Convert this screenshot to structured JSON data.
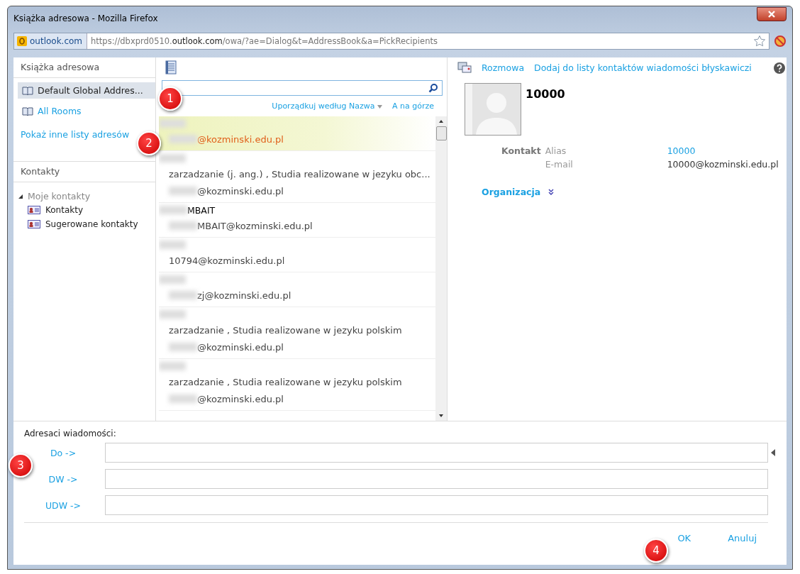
{
  "window": {
    "title": "Książka adresowa - Mozilla Firefox"
  },
  "address_bar": {
    "site": "outlook.com",
    "url_start": "https://dbxprd0510.",
    "url_domain": "outlook.com",
    "url_end": "/owa/?ae=Dialog&t=AddressBook&a=PickRecipients"
  },
  "sidebar": {
    "title": "Książka adresowa",
    "lists": [
      {
        "label": "Default Global Addres...",
        "selected": true
      },
      {
        "label": "All Rooms",
        "selected": false
      }
    ],
    "more_link": "Pokaż inne listy adresów",
    "contacts_title": "Kontakty",
    "tree": [
      {
        "label": "Moje kontakty",
        "expanded": true,
        "children": [
          {
            "label": "Kontakty"
          },
          {
            "label": "Sugerowane kontakty"
          }
        ]
      }
    ]
  },
  "list": {
    "sort": "Uporządkuj według Nazwa",
    "order": "A na górze",
    "rows": [
      {
        "selected": true,
        "name": "",
        "lines": [
          "@kozminski.edu.pl"
        ]
      },
      {
        "selected": false,
        "name": "",
        "lines": [
          "zarzadzanie (j. ang.) , Studia realizowane w jezyku obc...",
          "@kozminski.edu.pl"
        ]
      },
      {
        "selected": false,
        "name": "MBAIT",
        "lines": [
          "MBAIT@kozminski.edu.pl"
        ]
      },
      {
        "selected": false,
        "name": "",
        "lines": [
          "10794@kozminski.edu.pl"
        ]
      },
      {
        "selected": false,
        "name": "",
        "lines": [
          "zj@kozminski.edu.pl"
        ]
      },
      {
        "selected": false,
        "name": "",
        "lines": [
          "zarzadzanie , Studia realizowane w jezyku polskim",
          "@kozminski.edu.pl"
        ]
      },
      {
        "selected": false,
        "name": "",
        "lines": [
          "zarzadzanie , Studia realizowane w jezyku polskim",
          "@kozminski.edu.pl"
        ]
      }
    ]
  },
  "details": {
    "actions": [
      "Rozmowa",
      "Dodaj do listy kontaktów wiadomości błyskawiczi"
    ],
    "name": "10000",
    "section": "Kontakt",
    "fields": [
      {
        "label": "Alias",
        "value": "10000",
        "link": true
      },
      {
        "label": "E-mail",
        "value": "10000@kozminski.edu.pl",
        "link": false
      }
    ],
    "organization": "Organizacja"
  },
  "recipients": {
    "title": "Adresaci wiadomości:",
    "fields": [
      {
        "label": "Do ->"
      },
      {
        "label": "DW ->"
      },
      {
        "label": "UDW ->"
      }
    ]
  },
  "buttons": [
    "OK",
    "Anuluj"
  ],
  "callouts": [
    "1",
    "2",
    "3",
    "4"
  ]
}
